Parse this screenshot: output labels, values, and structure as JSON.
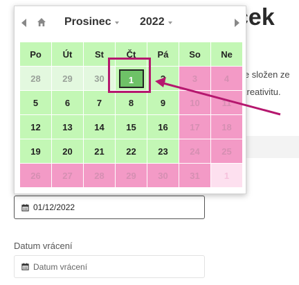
{
  "page": {
    "heading_fragment": "ček",
    "text_line1": "je složen ze",
    "text_line2": "kreativitu."
  },
  "date_input": {
    "value": "01/12/2022",
    "icon": "calendar-icon"
  },
  "return_field": {
    "label": "Datum vrácení",
    "placeholder": "Datum vrácení",
    "icon": "calendar-icon"
  },
  "picker": {
    "month": "Prosinec",
    "year": "2022",
    "icons": {
      "prev": "chevron-left-icon",
      "home": "home-icon",
      "next": "chevron-right-icon"
    },
    "weekdays": [
      "Po",
      "Út",
      "St",
      "Čt",
      "Pá",
      "So",
      "Ne"
    ],
    "weeks": [
      [
        {
          "d": "28",
          "s": "past"
        },
        {
          "d": "29",
          "s": "past"
        },
        {
          "d": "30",
          "s": "past"
        },
        {
          "d": "1",
          "s": "selected"
        },
        {
          "d": "2",
          "s": "avail"
        },
        {
          "d": "3",
          "s": "pink"
        },
        {
          "d": "4",
          "s": "pink"
        }
      ],
      [
        {
          "d": "5",
          "s": "avail"
        },
        {
          "d": "6",
          "s": "avail"
        },
        {
          "d": "7",
          "s": "avail"
        },
        {
          "d": "8",
          "s": "avail"
        },
        {
          "d": "9",
          "s": "avail"
        },
        {
          "d": "10",
          "s": "pink"
        },
        {
          "d": "11",
          "s": "pink"
        }
      ],
      [
        {
          "d": "12",
          "s": "avail"
        },
        {
          "d": "13",
          "s": "avail"
        },
        {
          "d": "14",
          "s": "avail"
        },
        {
          "d": "15",
          "s": "avail"
        },
        {
          "d": "16",
          "s": "avail"
        },
        {
          "d": "17",
          "s": "pink"
        },
        {
          "d": "18",
          "s": "pink"
        }
      ],
      [
        {
          "d": "19",
          "s": "avail"
        },
        {
          "d": "20",
          "s": "avail"
        },
        {
          "d": "21",
          "s": "avail"
        },
        {
          "d": "22",
          "s": "avail"
        },
        {
          "d": "23",
          "s": "avail"
        },
        {
          "d": "24",
          "s": "pink"
        },
        {
          "d": "25",
          "s": "pink"
        }
      ],
      [
        {
          "d": "26",
          "s": "pink"
        },
        {
          "d": "27",
          "s": "pink"
        },
        {
          "d": "28",
          "s": "pink"
        },
        {
          "d": "29",
          "s": "pink"
        },
        {
          "d": "30",
          "s": "pink"
        },
        {
          "d": "31",
          "s": "pink"
        },
        {
          "d": "1",
          "s": "pink-light"
        }
      ]
    ]
  },
  "colors": {
    "available": "#c3f7b5",
    "selected": "#6ec267",
    "unavailable": "#f39ac6",
    "annotation": "#b5176e"
  }
}
